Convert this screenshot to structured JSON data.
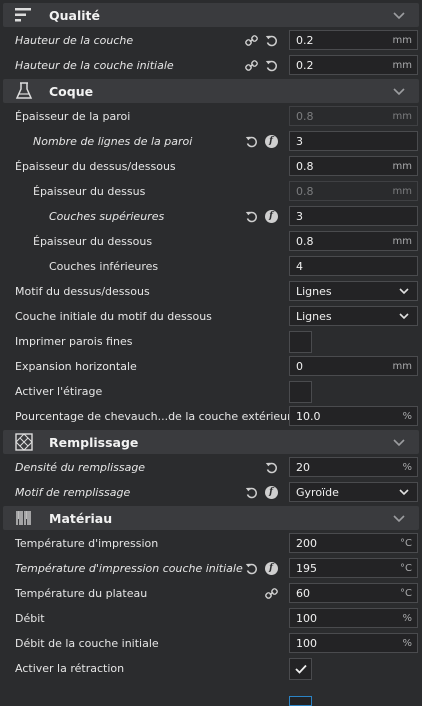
{
  "sections": {
    "qualite": "Qualité",
    "coque": "Coque",
    "remplissage": "Remplissage",
    "materiau": "Matériau"
  },
  "rows": {
    "hauteur_couche": {
      "label": "Hauteur de la couche",
      "value": "0.2",
      "unit": "mm"
    },
    "hauteur_couche_initiale": {
      "label": "Hauteur de la couche initiale",
      "value": "0.2",
      "unit": "mm"
    },
    "epaisseur_paroi": {
      "label": "Épaisseur de la paroi",
      "value": "0.8",
      "unit": "mm"
    },
    "nombre_lignes_paroi": {
      "label": "Nombre de lignes de la paroi",
      "value": "3"
    },
    "epaisseur_dessus_dessous": {
      "label": "Épaisseur du dessus/dessous",
      "value": "0.8",
      "unit": "mm"
    },
    "epaisseur_dessus": {
      "label": "Épaisseur du dessus",
      "value": "0.8",
      "unit": "mm"
    },
    "couches_superieures": {
      "label": "Couches supérieures",
      "value": "3"
    },
    "epaisseur_dessous": {
      "label": "Épaisseur du dessous",
      "value": "0.8",
      "unit": "mm"
    },
    "couches_inferieures": {
      "label": "Couches inférieures",
      "value": "4"
    },
    "motif_dessus_dessous": {
      "label": "Motif du dessus/dessous",
      "value": "Lignes"
    },
    "couche_initiale_motif": {
      "label": "Couche initiale du motif du dessous",
      "value": "Lignes"
    },
    "imprimer_parois_fines": {
      "label": "Imprimer parois fines"
    },
    "expansion_horizontale": {
      "label": "Expansion horizontale",
      "value": "0",
      "unit": "mm"
    },
    "activer_etirage": {
      "label": "Activer l'étirage"
    },
    "pourcentage_chevauchement": {
      "label": "Pourcentage de chevauch...de la couche extérieure",
      "value": "10.0",
      "unit": "%"
    },
    "densite_remplissage": {
      "label": "Densité du remplissage",
      "value": "20",
      "unit": "%"
    },
    "motif_remplissage": {
      "label": "Motif de remplissage",
      "value": "Gyroïde"
    },
    "temperature_impression": {
      "label": "Température d'impression",
      "value": "200",
      "unit": "°C"
    },
    "temperature_impression_initiale": {
      "label": "Température d'impression couche initiale",
      "value": "195",
      "unit": "°C"
    },
    "temperature_plateau": {
      "label": "Température du plateau",
      "value": "60",
      "unit": "°C"
    },
    "debit": {
      "label": "Débit",
      "value": "100",
      "unit": "%"
    },
    "debit_couche_initiale": {
      "label": "Débit de la couche initiale",
      "value": "100",
      "unit": "%"
    },
    "activer_retraction": {
      "label": "Activer la rétraction",
      "checked": true
    }
  },
  "icons": {
    "link": "link-icon",
    "reset": "reset-icon",
    "function": "function-icon"
  },
  "function_glyph": "f",
  "colors": {
    "background": "#2b2c2e",
    "section": "#3a3b3e",
    "field": "#232325",
    "accent": "#2b84c6"
  }
}
